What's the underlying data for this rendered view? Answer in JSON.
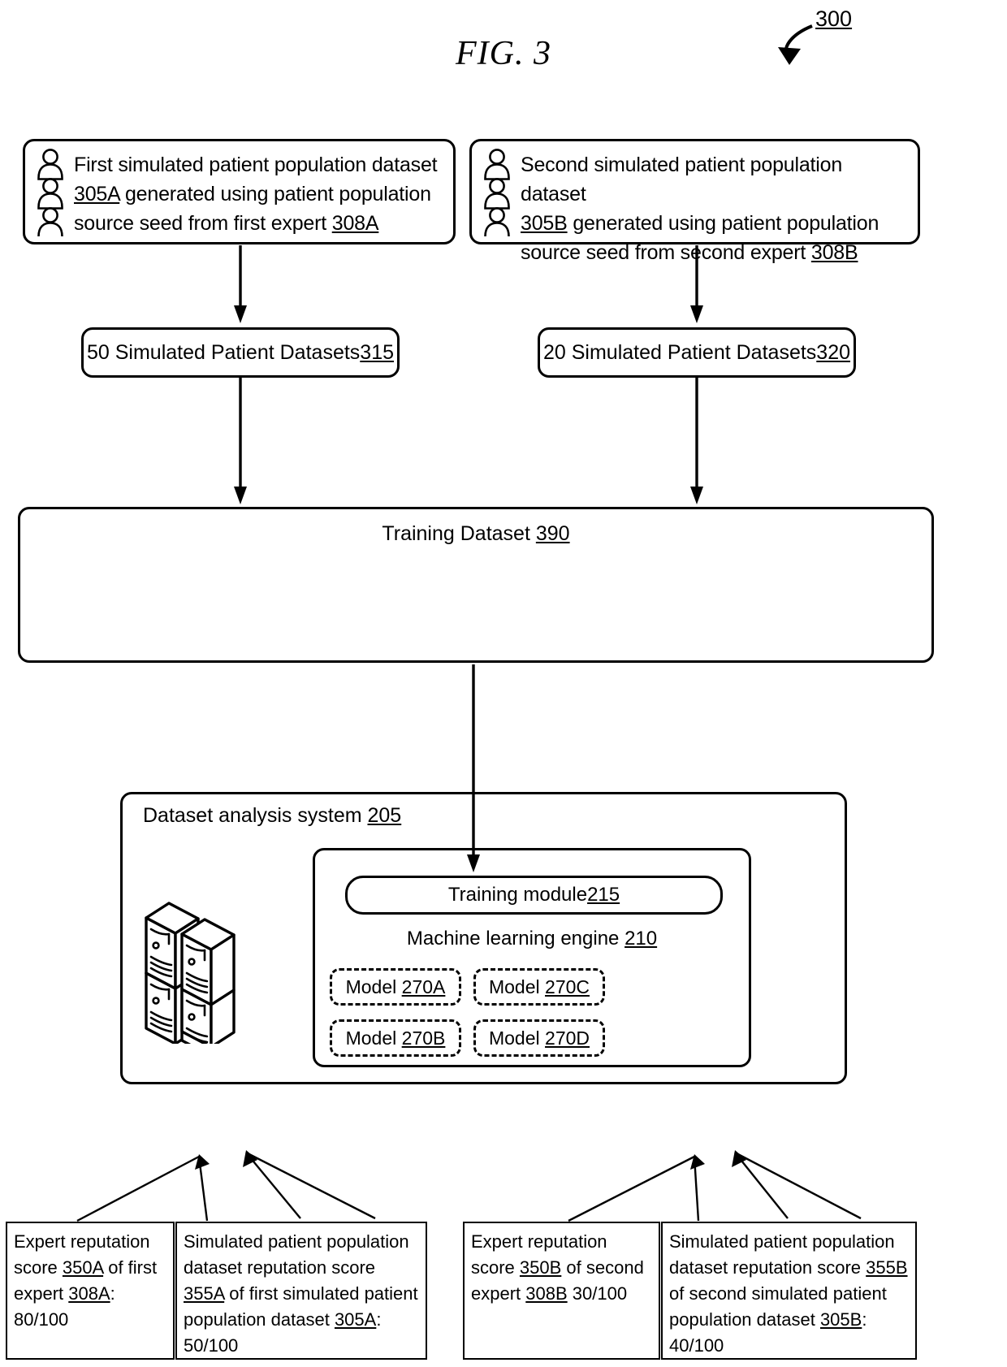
{
  "figure": {
    "title": "FIG. 3",
    "reference_numeral": "300"
  },
  "sources": [
    {
      "name": "first-source",
      "icon": "people-group-icon",
      "line1": "First simulated patient population dataset",
      "line2_ref": "305A",
      "line2_rest": " generated using patient population",
      "line3_pre": "source seed from first expert ",
      "line3_ref": "308A"
    },
    {
      "name": "second-source",
      "icon": "people-group-icon",
      "line1": "Second simulated patient population dataset",
      "line2_ref": "305B",
      "line2_rest": " generated using patient population",
      "line3_pre": "source seed from second expert ",
      "line3_ref": "308B"
    }
  ],
  "dataset_counts": [
    {
      "name": "left-dataset-count",
      "text": "50 Simulated Patient Datasets ",
      "ref": "315"
    },
    {
      "name": "right-dataset-count",
      "text": "20 Simulated Patient Datasets ",
      "ref": "320"
    }
  ],
  "training_dataset": {
    "label": "Training Dataset ",
    "ref": "390"
  },
  "dataset_analysis_system": {
    "title": "Dataset analysis system ",
    "title_ref": "205",
    "storage_icon": "server-stack-icon",
    "training_module": {
      "label": "Training module ",
      "ref": "215"
    },
    "machine_learning_engine": {
      "label": "Machine learning engine ",
      "ref": "210"
    },
    "models": [
      {
        "name": "model-270a",
        "label": "Model ",
        "ref": "270A"
      },
      {
        "name": "model-270c",
        "label": "Model ",
        "ref": "270C"
      },
      {
        "name": "model-270b",
        "label": "Model ",
        "ref": "270B"
      },
      {
        "name": "model-270d",
        "label": "Model ",
        "ref": "270D"
      }
    ]
  },
  "annotations": [
    {
      "name": "expert-reputation-score-a",
      "segments": [
        {
          "t": "Expert reputation score ",
          "u": false
        },
        {
          "t": "350A",
          "u": true
        },
        {
          "t": " of first expert ",
          "u": false
        },
        {
          "t": "308A",
          "u": true
        },
        {
          "t": ": 80/100",
          "u": false
        }
      ]
    },
    {
      "name": "dataset-reputation-score-a",
      "segments": [
        {
          "t": "Simulated patient population dataset reputation score ",
          "u": false
        },
        {
          "t": "355A",
          "u": true
        },
        {
          "t": " of first simulated patient population dataset ",
          "u": false
        },
        {
          "t": "305A",
          "u": true
        },
        {
          "t": ":  50/100",
          "u": false
        }
      ]
    },
    {
      "name": "expert-reputation-score-b",
      "segments": [
        {
          "t": "Expert reputation score ",
          "u": false
        },
        {
          "t": "350B",
          "u": true
        },
        {
          "t": " of second expert ",
          "u": false
        },
        {
          "t": "308B",
          "u": true
        },
        {
          "t": " 30/100",
          "u": false
        }
      ]
    },
    {
      "name": "dataset-reputation-score-b",
      "segments": [
        {
          "t": "Simulated patient population dataset reputation score ",
          "u": false
        },
        {
          "t": "355B",
          "u": true
        },
        {
          "t": " of second simulated patient population dataset ",
          "u": false
        },
        {
          "t": "305B",
          "u": true
        },
        {
          "t": ":  40/100",
          "u": false
        }
      ]
    }
  ],
  "colors": {
    "stroke": "#000000",
    "background": "#ffffff"
  }
}
